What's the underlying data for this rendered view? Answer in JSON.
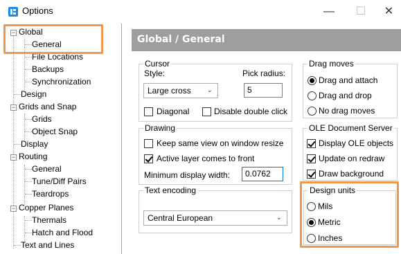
{
  "window": {
    "title": "Options",
    "minimize": "—",
    "maximize": "☐",
    "close": "✕"
  },
  "tree": {
    "items": [
      {
        "label": "Global",
        "expander": "−"
      },
      {
        "label": "General"
      },
      {
        "label": "File Locations"
      },
      {
        "label": "Backups"
      },
      {
        "label": "Synchronization"
      },
      {
        "label": "Design"
      },
      {
        "label": "Grids and Snap",
        "expander": "−"
      },
      {
        "label": "Grids"
      },
      {
        "label": "Object Snap"
      },
      {
        "label": "Display"
      },
      {
        "label": "Routing",
        "expander": "−"
      },
      {
        "label": "General"
      },
      {
        "label": "Tune/Diff Pairs"
      },
      {
        "label": "Teardrops"
      },
      {
        "label": "Copper Planes",
        "expander": "−"
      },
      {
        "label": "Thermals"
      },
      {
        "label": "Hatch and Flood"
      },
      {
        "label": "Text and Lines"
      }
    ]
  },
  "header": {
    "title": "Global / General"
  },
  "cursor": {
    "legend": "Cursor",
    "style_label": "Style:",
    "style_value": "Large cross",
    "pick_radius_label": "Pick radius:",
    "pick_radius_value": "5",
    "diagonal_label": "Diagonal",
    "disable_double_click_label": "Disable double click"
  },
  "drawing": {
    "legend": "Drawing",
    "keep_same_view_label": "Keep same view on window resize",
    "active_layer_label": "Active layer comes to front",
    "min_display_width_label": "Minimum display width:",
    "min_display_width_value": "0.0762"
  },
  "text_encoding": {
    "legend": "Text encoding",
    "value": "Central European"
  },
  "drag_moves": {
    "legend": "Drag moves",
    "options": [
      "Drag and attach",
      "Drag and drop",
      "No drag moves"
    ],
    "selected": "Drag and attach"
  },
  "ole": {
    "legend": "OLE Document Server",
    "display_objects_label": "Display OLE objects",
    "update_on_redraw_label": "Update on redraw",
    "draw_background_label": "Draw background"
  },
  "design_units": {
    "legend": "Design units",
    "options": [
      "Mils",
      "Metric",
      "Inches"
    ],
    "selected": "Metric"
  },
  "colors": {
    "highlight": "#f0974a",
    "header_bg": "#9e9e9e",
    "focus_border": "#0078d7"
  }
}
